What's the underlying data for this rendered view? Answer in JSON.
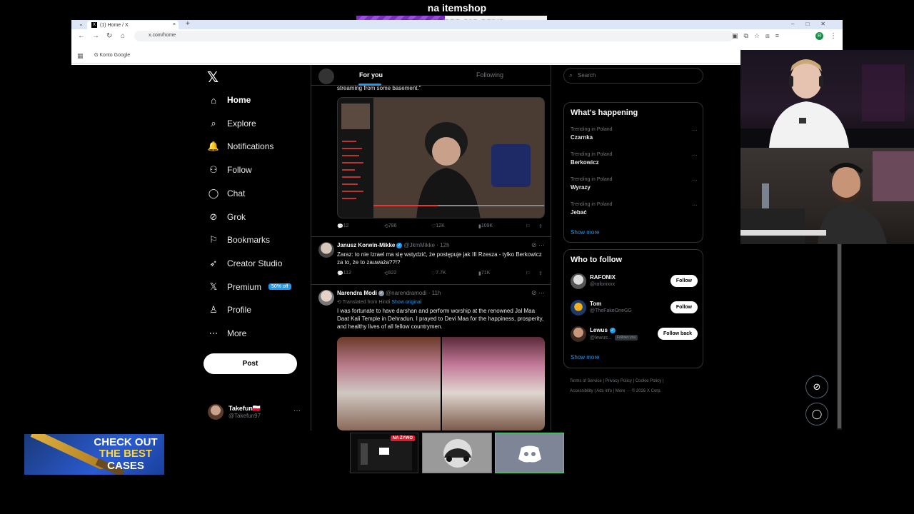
{
  "overlay": {
    "title": "na itemshop",
    "goal_text": "473.06 / 1020 (46.38%)",
    "goal_fraction": 0.4638,
    "promo": {
      "line1": "CHECK OUT",
      "line2": "THE BEST",
      "line3": "CASES"
    },
    "live_badge": "NA ŻYWO"
  },
  "browser": {
    "tab_title": "(1) Home / X",
    "tab_favicon": "X",
    "close_glyph": "×",
    "new_tab_glyph": "+",
    "url": "x.com/home",
    "bookmark": "Konto Google",
    "profile_initial": "R"
  },
  "x": {
    "logo": "𝕏",
    "nav": [
      {
        "label": "Home",
        "icon": "home-icon"
      },
      {
        "label": "Explore",
        "icon": "search-icon"
      },
      {
        "label": "Notifications",
        "icon": "bell-icon"
      },
      {
        "label": "Follow",
        "icon": "person-add-icon"
      },
      {
        "label": "Chat",
        "icon": "chat-icon"
      },
      {
        "label": "Grok",
        "icon": "grok-icon"
      },
      {
        "label": "Bookmarks",
        "icon": "bookmark-icon"
      },
      {
        "label": "Creator Studio",
        "icon": "rocket-icon"
      },
      {
        "label": "Premium",
        "icon": "x-icon",
        "badge": "50% off"
      },
      {
        "label": "Profile",
        "icon": "profile-icon"
      },
      {
        "label": "More",
        "icon": "more-circle-icon"
      }
    ],
    "post_button": "Post",
    "account": {
      "name": "Takefun🇵🇱",
      "handle": "@Takefun97",
      "more": "···"
    },
    "timeline": {
      "tab_for_you": "For you",
      "tab_following": "Following",
      "snippet": "streaming from some basement.\"",
      "tweet1_actions": {
        "replies": "12",
        "reposts": "786",
        "likes": "12K",
        "views": "109K"
      },
      "tweet2": {
        "name": "Janusz Korwin-Mikke",
        "handle": "@JkmMikke",
        "time": "· 12h",
        "text": "Zaraz: to nie Izrael ma się wstydzić, że postępuje jak III Rzesza - tylko Berkowicz za to, że to zauważa??!?",
        "actions": {
          "replies": "112",
          "reposts": "522",
          "likes": "7.7K",
          "views": "71K"
        }
      },
      "tweet3": {
        "name": "Narendra Modi",
        "handle": "@narendramodi",
        "time": "· 11h",
        "translated": "Translated from Hindi",
        "show_original": "Show original",
        "text": "I was fortunate to have darshan and perform worship at the renowned Jal Maa Daat Kali Temple in Dehradun. I prayed to Devi Maa for the happiness, prosperity, and healthy lives of all fellow countrymen."
      }
    },
    "sidebar": {
      "search_placeholder": "Search",
      "whats_happening": "What's happening",
      "trends": [
        {
          "context": "Trending in Poland",
          "title": "Czarnka"
        },
        {
          "context": "Trending in Poland",
          "title": "Berkowicz"
        },
        {
          "context": "Trending in Poland",
          "title": "Wyrazy"
        },
        {
          "context": "Trending in Poland",
          "title": "Jebać"
        }
      ],
      "show_more": "Show more",
      "who_to_follow": "Who to follow",
      "follow_suggestions": [
        {
          "name": "RAFONIX",
          "handle": "@rafonixxx",
          "button": "Follow"
        },
        {
          "name": "Tom",
          "handle": "@TheFakeOneGG",
          "button": "Follow"
        },
        {
          "name": "Lewus",
          "handle": "@lewus...",
          "follows_you": "Follows you",
          "button": "Follow back"
        }
      ],
      "footer_line1": "Terms of Service  |  Privacy Policy  |  Cookie Policy  |",
      "footer_line2": "Accessibility  |  Ads info  |  More ···  © 2026 X Corp."
    }
  },
  "colors": {
    "accent": "#1d9bf0",
    "goal_fill": "#7b2fbf",
    "live": "#e31c2d"
  }
}
